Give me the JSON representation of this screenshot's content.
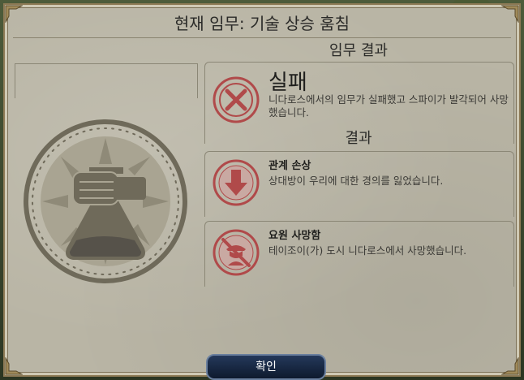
{
  "dialog": {
    "title": "현재 임무: 기술 상승 훔침"
  },
  "mission_result": {
    "heading": "임무 결과",
    "status": "실패",
    "description": "니다로스에서의 임무가 실패했고 스파이가 발각되어 사망했습니다."
  },
  "consequences": {
    "heading": "결과",
    "items": [
      {
        "title": "관계 손상",
        "description": "상대방이 우리에 대한 경의를 잃었습니다."
      },
      {
        "title": "요원 사망함",
        "description": "테이조이(가) 도시 니다로스에서 사망했습니다."
      }
    ]
  },
  "confirm_button": {
    "label": "확인"
  },
  "colors": {
    "panel": "#b9b5a5",
    "emblem": "#6f6a5a",
    "fail_red": "#b04a4a",
    "button": "#1a2a44"
  }
}
